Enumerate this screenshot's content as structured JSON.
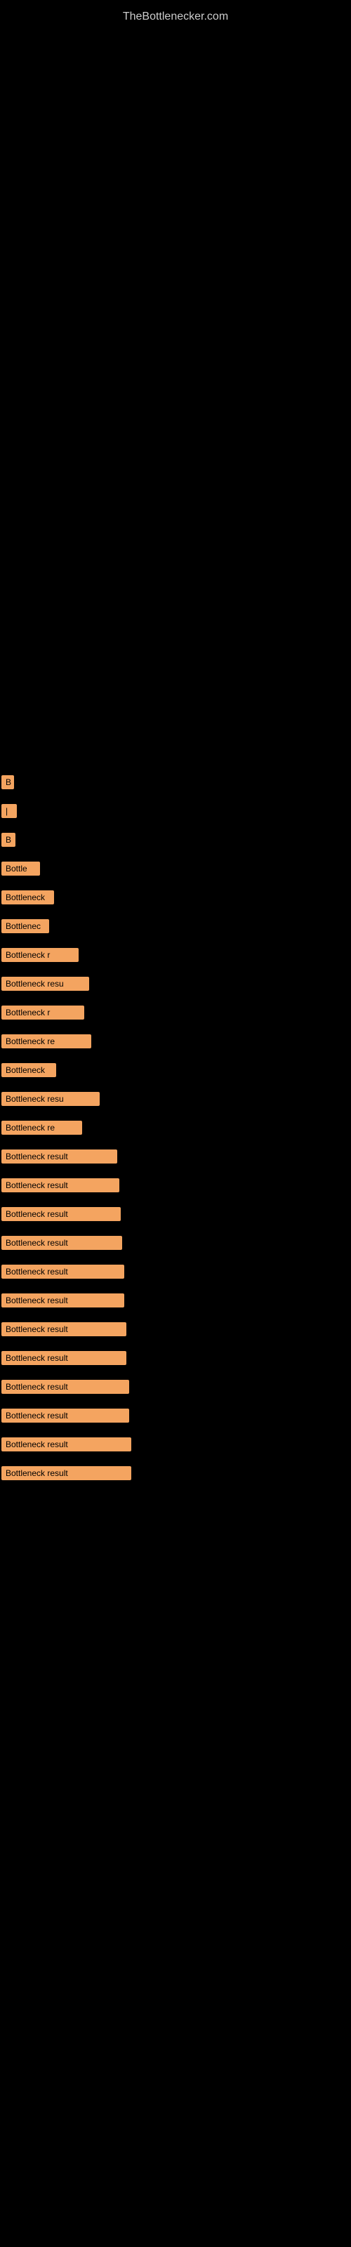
{
  "site": {
    "title": "TheBottlenecker.com"
  },
  "bars": [
    {
      "id": 1,
      "label": "B",
      "size_class": "bar-s1"
    },
    {
      "id": 2,
      "label": "|",
      "size_class": "bar-s2"
    },
    {
      "id": 3,
      "label": "B",
      "size_class": "bar-s3"
    },
    {
      "id": 4,
      "label": "Bottle",
      "size_class": "bar-s4"
    },
    {
      "id": 5,
      "label": "Bottleneck",
      "size_class": "bar-s5"
    },
    {
      "id": 6,
      "label": "Bottlenec",
      "size_class": "bar-s6"
    },
    {
      "id": 7,
      "label": "Bottleneck r",
      "size_class": "bar-s7"
    },
    {
      "id": 8,
      "label": "Bottleneck resu",
      "size_class": "bar-s8"
    },
    {
      "id": 9,
      "label": "Bottleneck r",
      "size_class": "bar-s9"
    },
    {
      "id": 10,
      "label": "Bottleneck re",
      "size_class": "bar-s10"
    },
    {
      "id": 11,
      "label": "Bottleneck",
      "size_class": "bar-s11"
    },
    {
      "id": 12,
      "label": "Bottleneck resu",
      "size_class": "bar-s12"
    },
    {
      "id": 13,
      "label": "Bottleneck re",
      "size_class": "bar-s13"
    },
    {
      "id": 14,
      "label": "Bottleneck result",
      "size_class": "bar-s14"
    },
    {
      "id": 15,
      "label": "Bottleneck result",
      "size_class": "bar-s15"
    },
    {
      "id": 16,
      "label": "Bottleneck result",
      "size_class": "bar-s16"
    },
    {
      "id": 17,
      "label": "Bottleneck result",
      "size_class": "bar-s17"
    },
    {
      "id": 18,
      "label": "Bottleneck result",
      "size_class": "bar-s18"
    },
    {
      "id": 19,
      "label": "Bottleneck result",
      "size_class": "bar-s19"
    },
    {
      "id": 20,
      "label": "Bottleneck result",
      "size_class": "bar-s20"
    },
    {
      "id": 21,
      "label": "Bottleneck result",
      "size_class": "bar-s21"
    },
    {
      "id": 22,
      "label": "Bottleneck result",
      "size_class": "bar-s22"
    },
    {
      "id": 23,
      "label": "Bottleneck result",
      "size_class": "bar-s23"
    },
    {
      "id": 24,
      "label": "Bottleneck result",
      "size_class": "bar-s24"
    },
    {
      "id": 25,
      "label": "Bottleneck result",
      "size_class": "bar-s25"
    }
  ]
}
